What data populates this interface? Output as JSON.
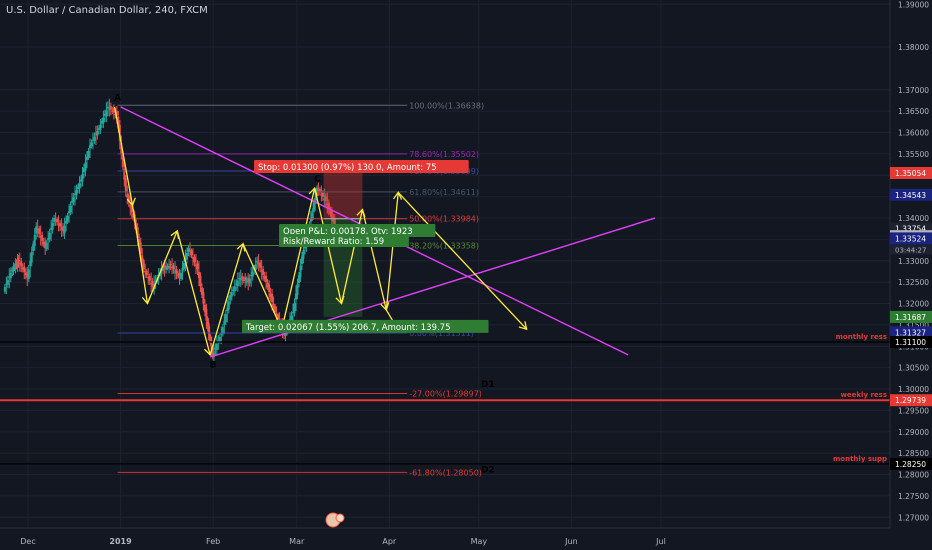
{
  "header": {
    "title": "U.S. Dollar / Canadian Dollar, 240, FXCM"
  },
  "colors": {
    "background": "#131722",
    "grid": "#1e2230",
    "axis_text": "#b2b5be",
    "wave": "#ffeb3b",
    "trend": "#e040fb",
    "stop": "#e53935",
    "target": "#2e7d32",
    "candle_up": "#26a69a",
    "candle_down": "#ef5350"
  },
  "chart_data": {
    "type": "candlestick",
    "symbol": "U.S. Dollar / Canadian Dollar",
    "interval": "240",
    "source": "FXCM",
    "ylim": [
      1.2675,
      1.391
    ],
    "y_ticks": [
      1.39,
      1.38,
      1.37,
      1.365,
      1.36,
      1.355,
      1.35,
      1.345,
      1.34,
      1.335,
      1.33,
      1.325,
      1.32,
      1.315,
      1.31,
      1.305,
      1.3,
      1.295,
      1.29,
      1.285,
      1.28,
      1.275,
      1.27
    ],
    "y_tick_labels": [
      "1.39000",
      "1.38000",
      "1.37000",
      "1.36500",
      "1.36000",
      "1.35500",
      "1.35000",
      "1.34500",
      "1.34000",
      "1.33500",
      "1.33000",
      "1.32500",
      "1.32000",
      "1.31500",
      "1.31000",
      "1.30500",
      "1.30000",
      "1.29500",
      "1.29000",
      "1.28500",
      "1.28000",
      "1.27500",
      "1.27000"
    ],
    "x_labels": [
      {
        "label": "Dec",
        "date": "2018-12-01"
      },
      {
        "label": "2019",
        "date": "2019-01-01"
      },
      {
        "label": "Feb",
        "date": "2019-02-01"
      },
      {
        "label": "Mar",
        "date": "2019-03-01"
      },
      {
        "label": "Apr",
        "date": "2019-04-01"
      },
      {
        "label": "May",
        "date": "2019-05-01"
      },
      {
        "label": "Jun",
        "date": "2019-06-01"
      },
      {
        "label": "Jul",
        "date": "2019-07-01"
      }
    ],
    "price_path": [
      {
        "date": "2018-11-23",
        "price": 1.323
      },
      {
        "date": "2018-11-26",
        "price": 1.328
      },
      {
        "date": "2018-11-28",
        "price": 1.33
      },
      {
        "date": "2018-12-01",
        "price": 1.326
      },
      {
        "date": "2018-12-04",
        "price": 1.338
      },
      {
        "date": "2018-12-07",
        "price": 1.333
      },
      {
        "date": "2018-12-10",
        "price": 1.34
      },
      {
        "date": "2018-12-13",
        "price": 1.337
      },
      {
        "date": "2018-12-16",
        "price": 1.344
      },
      {
        "date": "2018-12-19",
        "price": 1.349
      },
      {
        "date": "2018-12-22",
        "price": 1.357
      },
      {
        "date": "2018-12-25",
        "price": 1.361
      },
      {
        "date": "2018-12-28",
        "price": 1.366
      },
      {
        "date": "2018-12-31",
        "price": 1.364
      },
      {
        "date": "2019-01-03",
        "price": 1.346
      },
      {
        "date": "2019-01-06",
        "price": 1.339
      },
      {
        "date": "2019-01-09",
        "price": 1.328
      },
      {
        "date": "2019-01-12",
        "price": 1.324
      },
      {
        "date": "2019-01-15",
        "price": 1.328
      },
      {
        "date": "2019-01-18",
        "price": 1.329
      },
      {
        "date": "2019-01-21",
        "price": 1.326
      },
      {
        "date": "2019-01-24",
        "price": 1.333
      },
      {
        "date": "2019-01-27",
        "price": 1.328
      },
      {
        "date": "2019-01-30",
        "price": 1.316
      },
      {
        "date": "2019-02-01",
        "price": 1.308
      },
      {
        "date": "2019-02-04",
        "price": 1.313
      },
      {
        "date": "2019-02-07",
        "price": 1.322
      },
      {
        "date": "2019-02-10",
        "price": 1.326
      },
      {
        "date": "2019-02-13",
        "price": 1.325
      },
      {
        "date": "2019-02-16",
        "price": 1.33
      },
      {
        "date": "2019-02-19",
        "price": 1.325
      },
      {
        "date": "2019-02-22",
        "price": 1.318
      },
      {
        "date": "2019-02-25",
        "price": 1.313
      },
      {
        "date": "2019-02-28",
        "price": 1.318
      },
      {
        "date": "2019-03-03",
        "price": 1.331
      },
      {
        "date": "2019-03-06",
        "price": 1.34
      },
      {
        "date": "2019-03-08",
        "price": 1.347
      },
      {
        "date": "2019-03-11",
        "price": 1.344
      },
      {
        "date": "2019-03-14",
        "price": 1.338
      }
    ],
    "price_labels": [
      {
        "price": 1.35054,
        "label": "1.35054",
        "color": "#e53935"
      },
      {
        "price": 1.34543,
        "label": "1.34543",
        "color": "#1a237e"
      },
      {
        "price": 1.33754,
        "label": "1.33754",
        "color": "#1e2230"
      },
      {
        "price": 1.33576,
        "label": "1.33576",
        "color": "#b2b5be"
      },
      {
        "price": 1.33524,
        "label": "1.33524",
        "color": "#1a237e"
      },
      {
        "price": 1.31687,
        "label": "1.31687",
        "color": "#2e7d32"
      },
      {
        "price": 1.31327,
        "label": "1.31327",
        "color": "#1a237e"
      },
      {
        "price": 1.311,
        "label": "1.31100",
        "color": "#000000"
      },
      {
        "price": 1.29739,
        "label": "1.29739",
        "color": "#e53935"
      },
      {
        "price": 1.2825,
        "label": "1.28250",
        "color": "#000000"
      }
    ],
    "timer_label": "03:44:27",
    "fib_levels": [
      {
        "label": "100.00%(1.36638)",
        "price": 1.36638,
        "color": "#6b6e79"
      },
      {
        "label": "78.60%(1.35502)",
        "price": 1.35502,
        "color": "#9c27b0"
      },
      {
        "label": "71.40%(1.35099)",
        "price": 1.35099,
        "color": "#3949ab"
      },
      {
        "label": "61.80%(1.34611)",
        "price": 1.34611,
        "color": "#4a5568"
      },
      {
        "label": "50.00%(1.33984)",
        "price": 1.33984,
        "color": "#e53935"
      },
      {
        "label": "38.20%(1.33358)",
        "price": 1.33358,
        "color": "#558b2f"
      },
      {
        "label": "0.00%(1.31311)",
        "price": 1.31311,
        "color": "#3949ab"
      },
      {
        "label": "-27.00%(1.29897)",
        "price": 1.29897,
        "color": "#e53935"
      },
      {
        "label": "-61.80%(1.28050)",
        "price": 1.2805,
        "color": "#e53935"
      }
    ],
    "horizontal_lines": [
      {
        "price": 1.311,
        "label": "monthly ress",
        "color": "#000000"
      },
      {
        "price": 1.29739,
        "label": "weekly ress",
        "color": "#e53935"
      },
      {
        "price": 1.2825,
        "label": "monthly supp",
        "color": "#000000"
      }
    ],
    "wave_labels": [
      {
        "text": "A",
        "date": "2018-12-31",
        "price": 1.3675
      },
      {
        "text": "B",
        "date": "2019-02-01",
        "price": 1.305
      },
      {
        "text": "C",
        "date": "2019-03-08",
        "price": 1.3485
      },
      {
        "text": "D1",
        "date": "2019-05-04",
        "price": 1.3005
      },
      {
        "text": "D2",
        "date": "2019-05-04",
        "price": 1.2805
      }
    ],
    "wave_path": [
      {
        "date": "2018-12-30",
        "price": 1.366
      },
      {
        "date": "2019-01-05",
        "price": 1.343
      },
      {
        "date": "2019-01-10",
        "price": 1.32
      },
      {
        "date": "2019-01-20",
        "price": 1.337
      },
      {
        "date": "2019-01-31",
        "price": 1.308
      },
      {
        "date": "2019-02-11",
        "price": 1.334
      },
      {
        "date": "2019-02-24",
        "price": 1.314
      },
      {
        "date": "2019-03-07",
        "price": 1.347
      },
      {
        "date": "2019-03-16",
        "price": 1.32
      },
      {
        "date": "2019-03-23",
        "price": 1.342
      },
      {
        "date": "2019-03-31",
        "price": 1.3185
      },
      {
        "date": "2019-04-04",
        "price": 1.346
      },
      {
        "date": "2019-05-17",
        "price": 1.314
      }
    ],
    "trend_lines": [
      {
        "from": {
          "date": "2019-01-01",
          "price": 1.366
        },
        "to": {
          "date": "2019-06-20",
          "price": 1.308
        }
      },
      {
        "from": {
          "date": "2019-01-31",
          "price": 1.3075
        },
        "to": {
          "date": "2019-06-29",
          "price": 1.34
        }
      }
    ],
    "position": {
      "entry": 1.33984,
      "stop": 1.35054,
      "target": 1.31687,
      "start": "2019-03-10",
      "end": "2019-03-23",
      "stop_label": "Stop: 0.01300 (0.97%) 130.0, Amount: 75",
      "target_label": "Target: 0.02067 (1.55%) 206.7, Amount: 139.75",
      "pnl_label": "Open P&L: 0.00178, Qty: 1923",
      "rr_label": "Risk/Reward Ratio: 1.59"
    }
  }
}
